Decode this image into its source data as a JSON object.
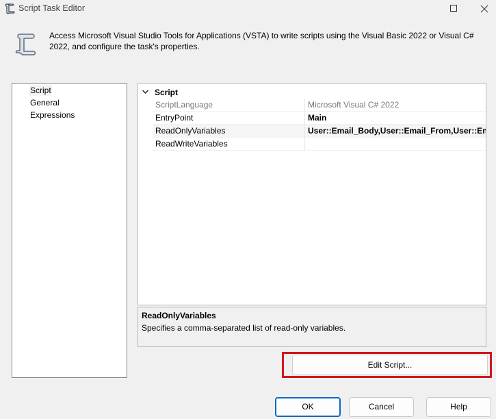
{
  "window": {
    "title": "Script Task Editor",
    "icon": "script-scroll-icon"
  },
  "header": {
    "description": "Access Microsoft Visual Studio Tools for Applications (VSTA) to write scripts using the Visual Basic 2022 or Visual C# 2022, and configure the task's properties."
  },
  "nav": {
    "items": [
      {
        "label": "Script",
        "selected": true
      },
      {
        "label": "General",
        "selected": false
      },
      {
        "label": "Expressions",
        "selected": false
      }
    ]
  },
  "property_grid": {
    "category": "Script",
    "properties": [
      {
        "name": "ScriptLanguage",
        "value": "Microsoft Visual C# 2022"
      },
      {
        "name": "EntryPoint",
        "value": "Main"
      },
      {
        "name": "ReadOnlyVariables",
        "value": "User::Email_Body,User::Email_From,User::Email_"
      },
      {
        "name": "ReadWriteVariables",
        "value": ""
      }
    ]
  },
  "description_panel": {
    "title": "ReadOnlyVariables",
    "text": "Specifies a comma-separated list of read-only variables."
  },
  "buttons": {
    "edit_script": "Edit Script...",
    "ok": "OK",
    "cancel": "Cancel",
    "help": "Help"
  },
  "colors": {
    "highlight": "#d2161c",
    "default_button_border": "#0067c0"
  }
}
